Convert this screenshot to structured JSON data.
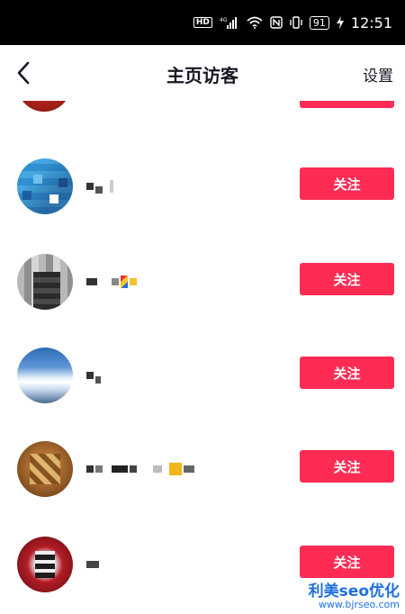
{
  "status_bar": {
    "hd_badge": "HD",
    "network": "4G",
    "battery": "91",
    "time": "12:51",
    "icons": [
      "hd-icon",
      "signal-icon",
      "wifi-icon",
      "nfc-icon",
      "vibrate-icon",
      "battery-icon",
      "charging-icon"
    ]
  },
  "nav": {
    "back_icon": "chevron-left-icon",
    "title": "主页访客",
    "settings_label": "设置"
  },
  "visitors": [
    {
      "follow_label": "关注"
    },
    {
      "follow_label": "关注"
    },
    {
      "follow_label": "关注"
    },
    {
      "follow_label": "关注"
    },
    {
      "follow_label": "关注"
    }
  ],
  "colors": {
    "accent": "#fe2c55",
    "status_bar_bg": "#000000",
    "text_primary": "#161823"
  },
  "watermark": {
    "main": "利美seo优化",
    "sub": "www.bjrseo.com"
  }
}
